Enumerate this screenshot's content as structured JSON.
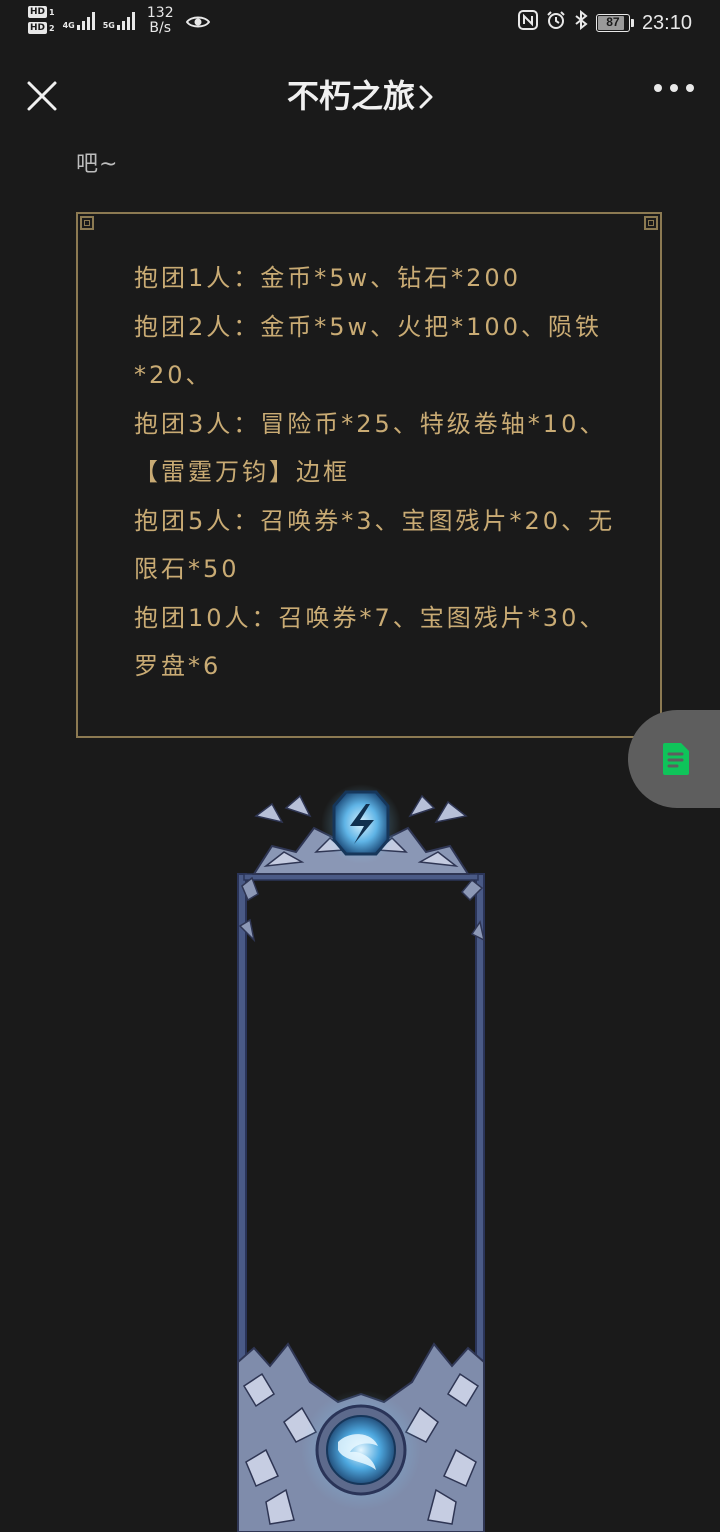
{
  "status_bar": {
    "hd1": "HD",
    "hd1_sub": "1",
    "hd2": "HD",
    "hd2_sub": "2",
    "net1": "4G",
    "net2": "5G",
    "speed_value": "132",
    "speed_unit": "B/s",
    "battery": "87",
    "battery_level": 0.87,
    "time": "23:10",
    "icons": [
      "nfc-icon",
      "alarm-icon",
      "bluetooth-icon"
    ]
  },
  "header": {
    "title": "不朽之旅",
    "close_icon": "close-icon",
    "title_icon": "chevron-right-icon",
    "more_icon": "more-dots-icon"
  },
  "article": {
    "lead": "吧~",
    "rewards": [
      "抱团1人：金币*5w、钻石*200",
      "抱团2人：金币*5w、火把*100、陨铁*20、",
      "抱团3人：冒险币*25、特级卷轴*10、【雷霆万钧】边框",
      "抱团5人：召唤券*3、宝图残片*20、无限石*50",
      "抱团10人：召唤券*7、宝图残片*30、罗盘*6"
    ]
  },
  "floating_button": {
    "icon": "note-icon",
    "color": "#0fc45a"
  },
  "colors": {
    "background": "#1a1a1a",
    "border_gold": "#8c7a52",
    "text_gold": "#c9ab74"
  }
}
